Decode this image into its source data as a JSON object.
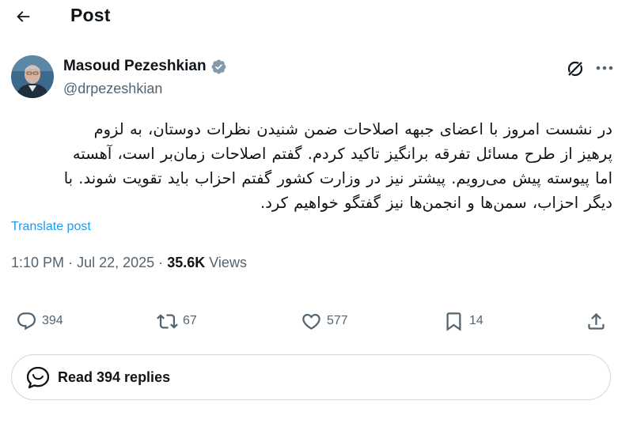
{
  "header": {
    "back_icon": "arrow-left-icon",
    "title": "Post"
  },
  "author": {
    "display_name": "Masoud Pezeshkian",
    "handle": "@drpezeshkian",
    "verified_icon": "verified-badge-icon",
    "verified_color": "#829aab",
    "grok_icon": "grok-icon",
    "more_icon": "more-horizontal-icon"
  },
  "post": {
    "lines": [
      "در نشست امروز با اعضای جبهه اصلاحات ضمن شنیدن نظرات دوستان، به لزوم",
      "پرهیز از طرح مسائل تفرقه برانگیز تاکید کردم. گفتم  اصلاحات زمان‌بر است، آهسته",
      "اما پیوسته پیش می‌رویم. پیشتر نیز در وزارت کشور گفتم احزاب باید تقویت شوند. با",
      "دیگر احزاب، سمن‌ها و انجمن‌ها نیز گفتگو خواهیم کرد."
    ],
    "translate_label": "Translate post"
  },
  "meta": {
    "time": "1:10 PM",
    "date": "Jul 22, 2025",
    "separator": "·",
    "views_count": "35.6K",
    "views_label": "Views"
  },
  "actions": {
    "reply": {
      "icon": "reply-icon",
      "count": "394"
    },
    "repost": {
      "icon": "repost-icon",
      "count": "67"
    },
    "like": {
      "icon": "heart-icon",
      "count": "577"
    },
    "bookmark": {
      "icon": "bookmark-icon",
      "count": "14"
    },
    "share": {
      "icon": "share-icon"
    }
  },
  "read_replies": {
    "icon": "conversation-icon",
    "label": "Read 394 replies"
  },
  "colors": {
    "text": "#0f1419",
    "secondary": "#536471",
    "link": "#1d9bf0",
    "border": "#cfd9de"
  }
}
